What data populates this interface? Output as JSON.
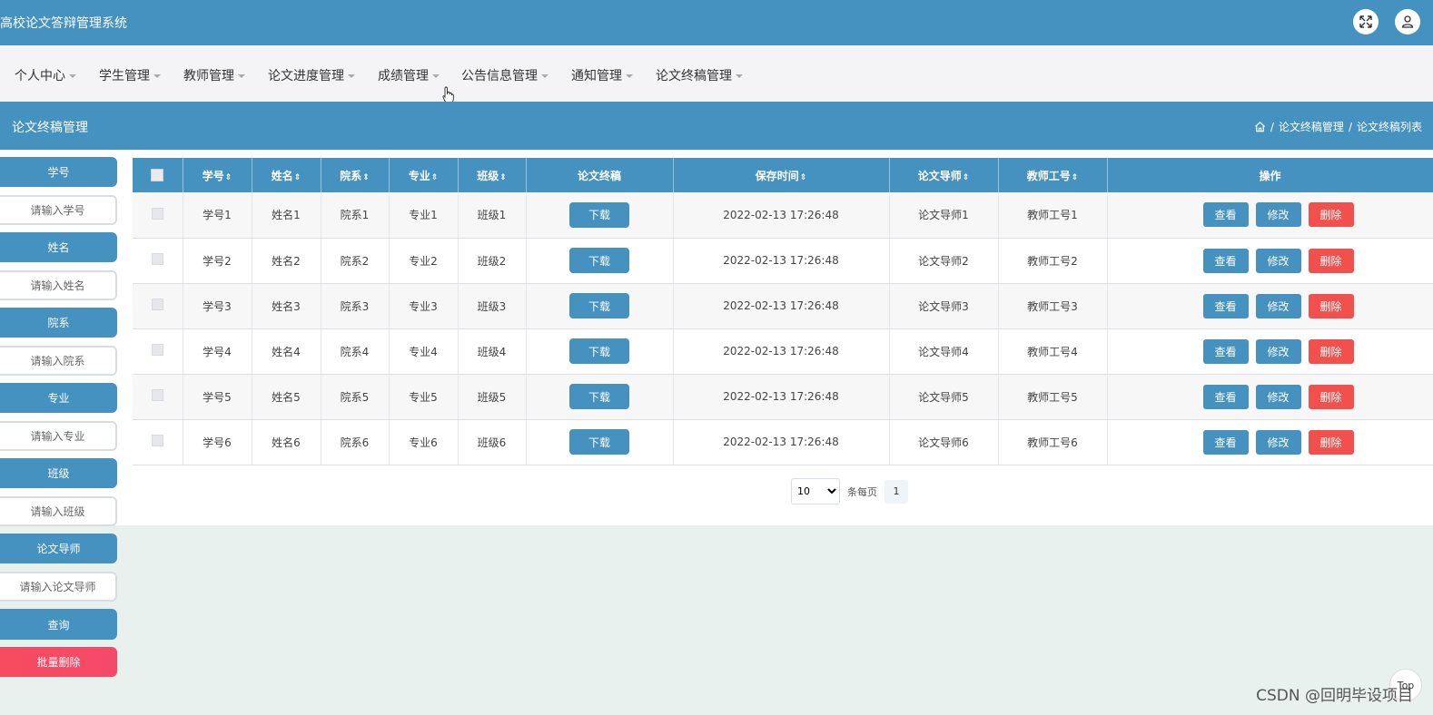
{
  "app": {
    "title": "高校论文答辩管理系统"
  },
  "header_icons": {
    "fullscreen": "fullscreen-icon",
    "user": "user-icon"
  },
  "nav": {
    "items": [
      {
        "label": "个人中心"
      },
      {
        "label": "学生管理"
      },
      {
        "label": "教师管理"
      },
      {
        "label": "论文进度管理"
      },
      {
        "label": "成绩管理"
      },
      {
        "label": "公告信息管理"
      },
      {
        "label": "通知管理"
      },
      {
        "label": "论文终稿管理"
      }
    ]
  },
  "section": {
    "title": "论文终稿管理",
    "breadcrumb": [
      "论文终稿管理",
      "论文终稿列表"
    ],
    "sep": "/"
  },
  "search": {
    "fields": [
      {
        "label": "学号",
        "placeholder": "请输入学号"
      },
      {
        "label": "姓名",
        "placeholder": "请输入姓名"
      },
      {
        "label": "院系",
        "placeholder": "请输入院系"
      },
      {
        "label": "专业",
        "placeholder": "请输入专业"
      },
      {
        "label": "班级",
        "placeholder": "请输入班级"
      },
      {
        "label": "论文导师",
        "placeholder": "请输入论文导师"
      }
    ],
    "query_label": "查询",
    "batch_delete_label": "批量删除"
  },
  "table": {
    "headers": [
      "学号",
      "姓名",
      "院系",
      "专业",
      "班级",
      "论文终稿",
      "保存时间",
      "论文导师",
      "教师工号",
      "操作"
    ],
    "sort_icon": "⇕",
    "rows": [
      {
        "id": "学号1",
        "name": "姓名1",
        "dept": "院系1",
        "major": "专业1",
        "cls": "班级1",
        "time": "2022-02-13 17:26:48",
        "tutor": "论文导师1",
        "tid": "教师工号1"
      },
      {
        "id": "学号2",
        "name": "姓名2",
        "dept": "院系2",
        "major": "专业2",
        "cls": "班级2",
        "time": "2022-02-13 17:26:48",
        "tutor": "论文导师2",
        "tid": "教师工号2"
      },
      {
        "id": "学号3",
        "name": "姓名3",
        "dept": "院系3",
        "major": "专业3",
        "cls": "班级3",
        "time": "2022-02-13 17:26:48",
        "tutor": "论文导师3",
        "tid": "教师工号3"
      },
      {
        "id": "学号4",
        "name": "姓名4",
        "dept": "院系4",
        "major": "专业4",
        "cls": "班级4",
        "time": "2022-02-13 17:26:48",
        "tutor": "论文导师4",
        "tid": "教师工号4"
      },
      {
        "id": "学号5",
        "name": "姓名5",
        "dept": "院系5",
        "major": "专业5",
        "cls": "班级5",
        "time": "2022-02-13 17:26:48",
        "tutor": "论文导师5",
        "tid": "教师工号5"
      },
      {
        "id": "学号6",
        "name": "姓名6",
        "dept": "院系6",
        "major": "专业6",
        "cls": "班级6",
        "time": "2022-02-13 17:26:48",
        "tutor": "论文导师6",
        "tid": "教师工号6"
      }
    ],
    "download_label": "下载",
    "view_label": "查看",
    "edit_label": "修改",
    "delete_label": "删除"
  },
  "pagination": {
    "page_size": "10",
    "page_size_options": [
      "10"
    ],
    "per_page_label": "条每页",
    "current_page": "1"
  },
  "back_to_top": "Top",
  "watermark": "CSDN @回明毕设项目",
  "colors": {
    "primary": "#4592c0",
    "danger": "#f2504c",
    "nav_bg": "#f4f3f5",
    "page_bg": "#e8f1ed"
  }
}
